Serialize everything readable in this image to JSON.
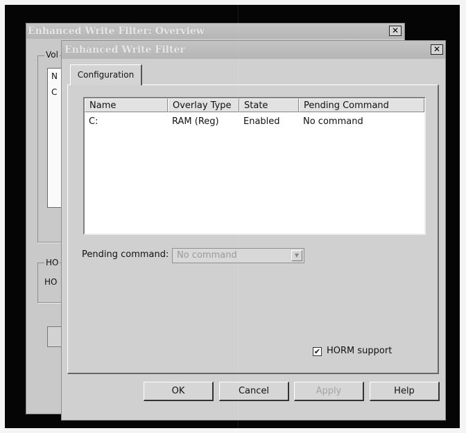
{
  "back_window": {
    "title": "Enhanced Write Filter: Overview",
    "close_glyph": "✕",
    "group1_label": "Vol",
    "list_header_fragment": "N",
    "list_item_fragment": "C",
    "group2_label": "HO",
    "group2_text": "HO"
  },
  "front_window": {
    "title": "Enhanced Write Filter",
    "close_glyph": "✕",
    "tab_label": "Configuration",
    "columns": [
      "Name",
      "Overlay Type",
      "State",
      "Pending Command"
    ],
    "rows": [
      {
        "name": "C:",
        "overlay_type": "RAM (Reg)",
        "state": "Enabled",
        "pending_command": "No command"
      }
    ],
    "pending_command_label": "Pending command:",
    "pending_command_value": "No command",
    "combo_arrow_glyph": "▼",
    "horm_label": "HORM support",
    "horm_checked": true,
    "check_glyph": "✔",
    "buttons": {
      "ok": "OK",
      "cancel": "Cancel",
      "apply": "Apply",
      "help": "Help"
    }
  }
}
